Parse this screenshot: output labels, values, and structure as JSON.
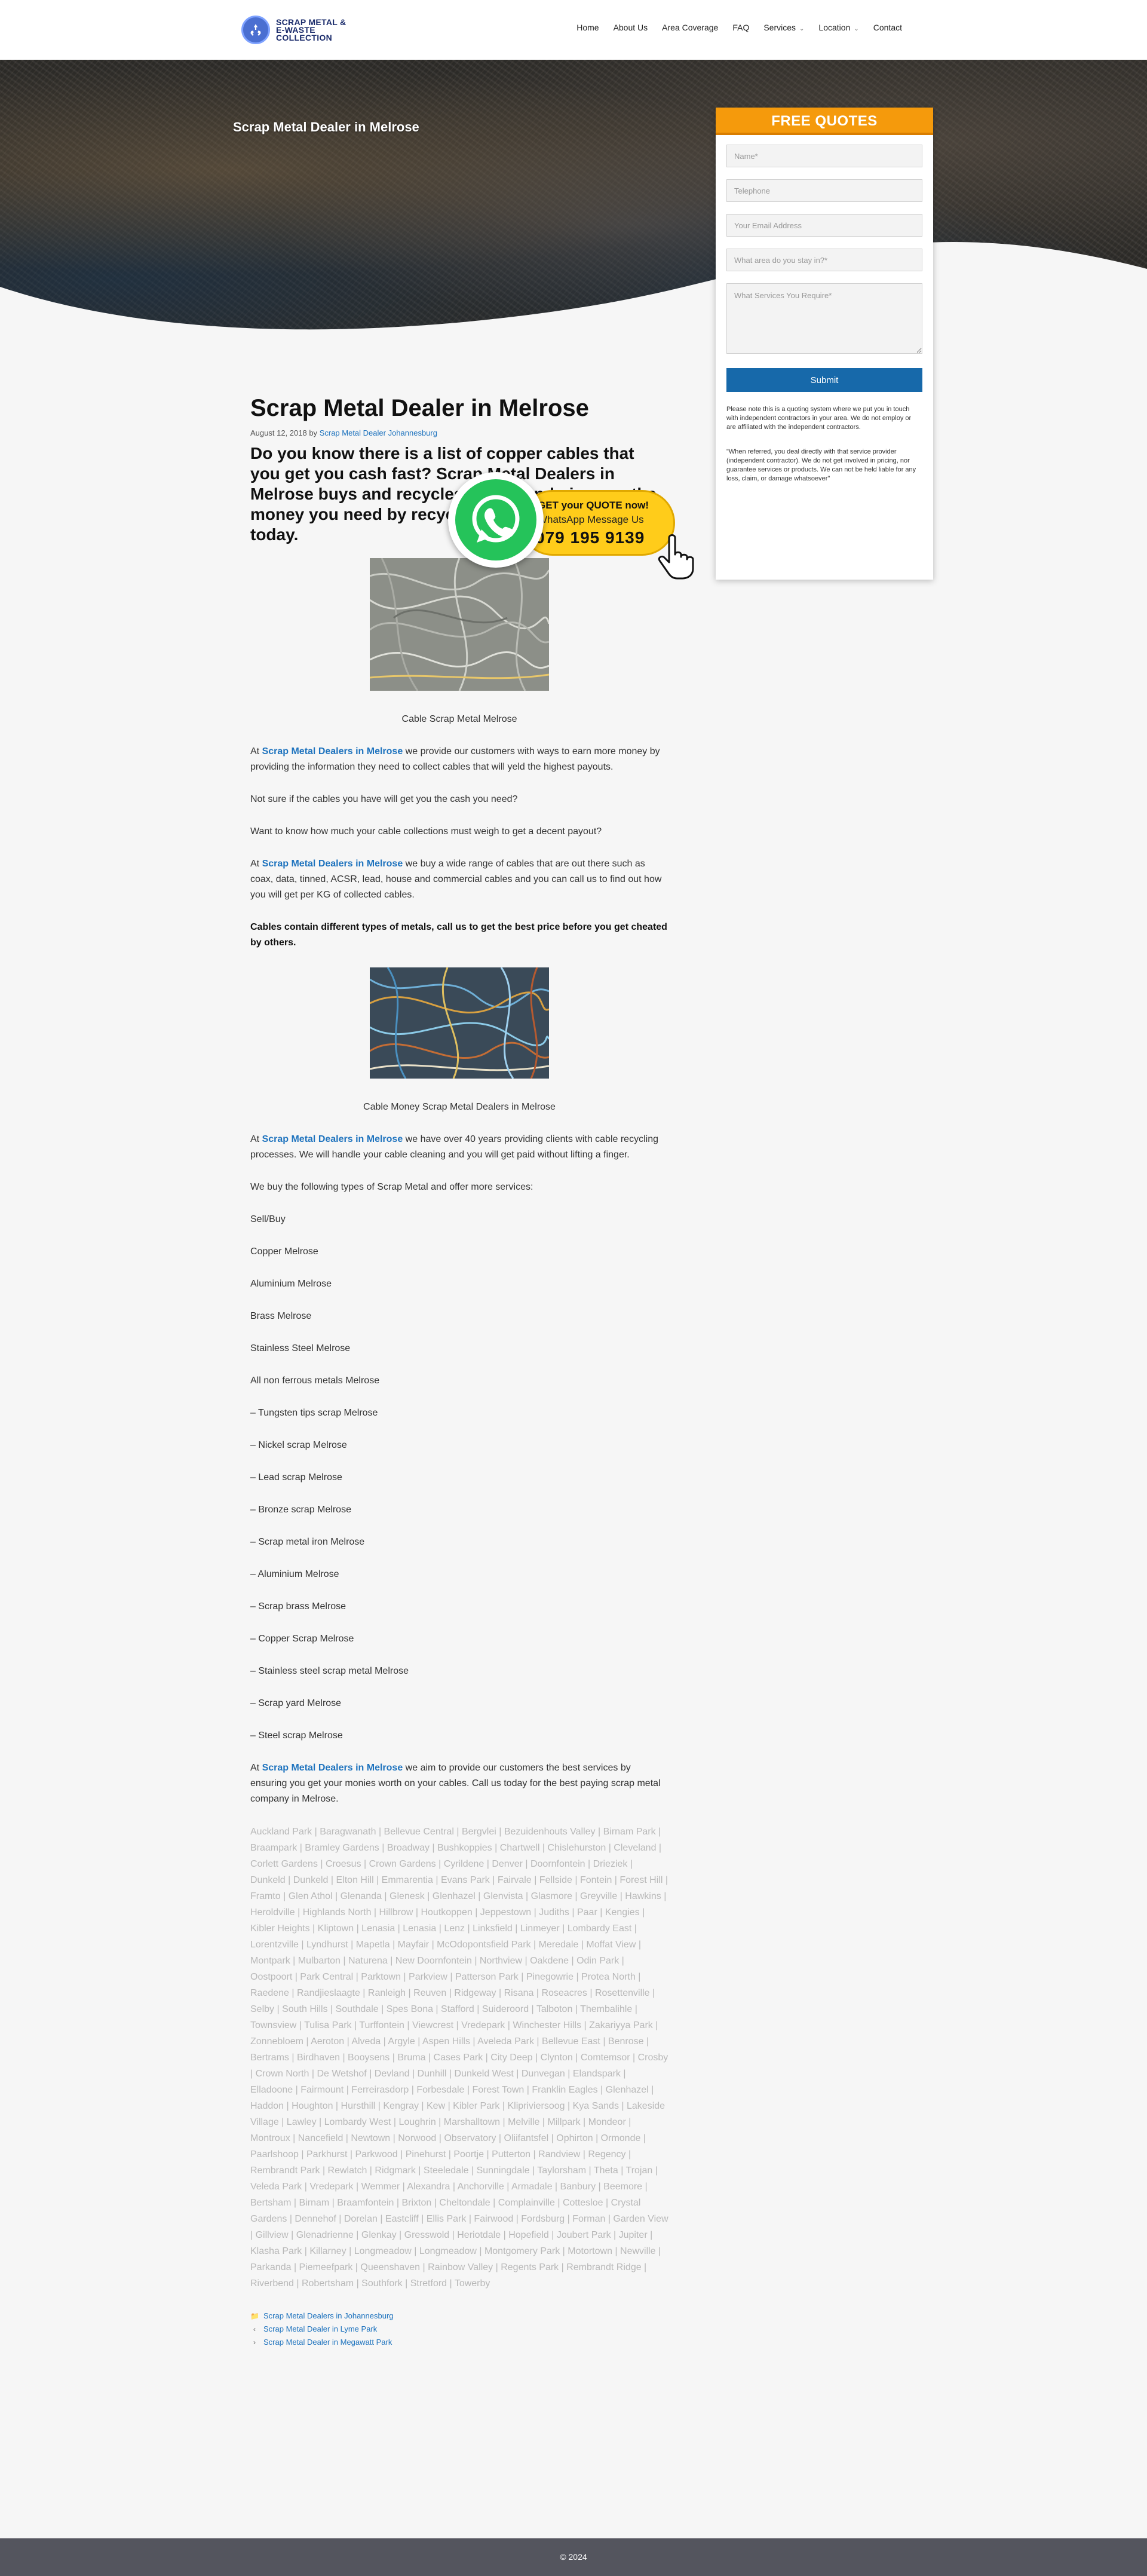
{
  "header": {
    "logo_text": "SCRAP METAL & E-WASTE COLLECTION",
    "nav": [
      {
        "label": "Home"
      },
      {
        "label": "About Us"
      },
      {
        "label": "Area Coverage"
      },
      {
        "label": "FAQ"
      },
      {
        "label": "Services",
        "has_dropdown": true
      },
      {
        "label": "Location",
        "has_dropdown": true
      },
      {
        "label": "Contact"
      }
    ]
  },
  "hero": {
    "title": "Scrap Metal Dealer in Melrose"
  },
  "quote_form": {
    "title": "FREE QUOTES",
    "name_placeholder": "Name*",
    "phone_placeholder": "Telephone",
    "email_placeholder": "Your Email Address",
    "area_placeholder": "What area do you stay in?*",
    "services_placeholder": "What Services You Require*",
    "submit_label": "Submit",
    "note1": "Please note this is a quoting system where we put you in touch with independent contractors in your area. We do not employ or are affiliated with the independent contractors.",
    "note2": "\"When referred, you deal directly with that service provider (independent contractor). We do not get involved in pricing, nor guarantee services or products. We can not be held liable for any loss, claim, or damage whatsoever\""
  },
  "whatsapp": {
    "cta": "GET your QUOTE now!",
    "message": "WhatsApp Message Us",
    "number": "079 195 9139"
  },
  "article": {
    "title": "Scrap Metal Dealer in Melrose",
    "date": "August 12, 2018",
    "by": "by",
    "author": "Scrap Metal Dealer Johannesburg",
    "lead": "Do you know there is a list of copper cables that you get you cash fast? Scrap Metal Dealers in Melrose buys and recycles cables and give you the money you need by recycling your copper cables today.",
    "caption1": "Cable Scrap Metal  Melrose",
    "p1_pre": "At ",
    "p1_link": "Scrap Metal Dealers in Melrose",
    "p1_post": " we provide our customers with ways to earn more money by providing the information they need to collect cables that will yeld the highest payouts.",
    "p2": "Not sure if the cables you have will get you the cash you need?",
    "p3": "Want to know how much your cable collections must weigh to get a decent payout?",
    "p4_pre": "At ",
    "p4_link": "Scrap Metal Dealers in Melrose",
    "p4_post": " we buy a wide range of cables that are out there such as coax, data, tinned, ACSR, lead, house and commercial cables and you can call us to find out how you will get per KG of collected cables.",
    "p5": "Cables contain different types of metals, call us to get the best price before you get cheated by others.",
    "caption2": "Cable Money Scrap Metal Dealers in Melrose",
    "p6_pre": "At ",
    "p6_link": "Scrap Metal Dealers in Melrose",
    "p6_post": " we have over 40 years providing clients with cable recycling processes. We will handle your cable cleaning and you will get paid without lifting a finger.",
    "p7": "We buy the following types of Scrap Metal and offer more services:",
    "list": [
      "Sell/Buy",
      "Copper Melrose",
      "Aluminium Melrose",
      "Brass Melrose",
      "Stainless Steel  Melrose",
      "All non ferrous metals Melrose",
      "– Tungsten tips scrap Melrose",
      "– Nickel scrap Melrose",
      "– Lead scrap Melrose",
      "– Bronze scrap Melrose",
      "– Scrap metal iron Melrose",
      "– Aluminium Melrose",
      "– Scrap brass Melrose",
      "– Copper Scrap Melrose",
      "– Stainless steel scrap metal Melrose",
      "– Scrap yard Melrose",
      "– Steel scrap Melrose"
    ],
    "p8_pre": "At ",
    "p8_link": "Scrap Metal Dealers in Melrose",
    "p8_post": " we aim to provide our customers the best services by ensuring you get your monies worth on your cables. Call us today for the best paying scrap metal company in Melrose.",
    "areas": "Auckland Park | Baragwanath | Bellevue Central | Bergvlei | Bezuidenhouts Valley | Birnam Park | Braampark | Bramley Gardens | Broadway | Bushkoppies | Chartwell | Chislehurston | Cleveland | Corlett Gardens | Croesus | Crown Gardens | Cyrildene | Denver | Doornfontein | Drieziek | Dunkeld | Dunkeld | Elton Hill | Emmarentia | Evans Park | Fairvale | Fellside | Fontein | Forest Hill | Framto | Glen Athol | Glenanda | Glenesk | Glenhazel | Glenvista | Glasmore | Greyville | Hawkins | Heroldville | Highlands North | Hillbrow | Houtkoppen | Jeppestown | Judiths | Paar | Kengies | Kibler Heights | Kliptown | Lenasia | Lenasia | Lenz | Linksfield | Linmeyer | Lombardy East | Lorentzville | Lyndhurst | Mapetla | Mayfair | McOdopontsfield Park | Meredale | Moffat View | Montpark | Mulbarton | Naturena | New Doornfontein | Northview | Oakdene | Odin Park | Oostpoort | Park Central | Parktown | Parkview | Patterson Park | Pinegowrie | Protea North | Raedene | Randjieslaagte | Ranleigh | Reuven | Ridgeway | Risana | Roseacres | Rosettenville | Selby | South Hills | Southdale | Spes Bona | Stafford | Suideroord | Talboton | Thembalihle | Townsview | Tulisa Park | Turffontein | Viewcrest | Vredepark | Winchester Hills | Zakariyya Park | Zonnebloem | Aeroton | Alveda | Argyle | Aspen Hills | Aveleda Park | Bellevue East | Benrose | Bertrams | Birdhaven | Booysens | Bruma | Cases Park | City Deep | Clynton | Comtemsor | Crosby | Crown North | De Wetshof | Devland | Dunhill | Dunkeld West | Dunvegan | Elandspark | Elladoone | Fairmount | Ferreirasdorp | Forbesdale | Forest Town | Franklin Eagles | Glenhazel | Haddon | Houghton | Hursthill | Kengray | Kew | Kibler Park | Klipriviersoog | Kya Sands | Lakeside Village | Lawley | Lombardy West | Loughrin | Marshalltown | Melville | Millpark | Mondeor | Montroux | Nancefield | Newtown | Norwood | Observatory | Oliifantsfel | Ophirton | Ormonde | Paarlshoop | Parkhurst | Parkwood | Pinehurst | Poortje | Putterton | Randview | Regency | Rembrandt Park | Rewlatch | Ridgmark | Steeledale | Sunningdale | Taylorsham | Theta | Trojan | Veleda Park | Vredepark | Wemmer | Alexandra | Anchorville | Armadale | Banbury | Beemore | Bertsham | Birnam | Braamfontein | Brixton | Cheltondale | Complainville | Cottesloe | Crystal Gardens | Dennehof | Dorelan | Eastcliff | Ellis Park | Fairwood | Fordsburg | Forman | Garden View | Gillview | Glenadrienne | Glenkay | Gresswold | Heriotdale | Hopefield | Joubert Park | Jupiter | Klasha Park | Killarney | Longmeadow | Longmeadow | Montgomery Park | Motortown | Newville | Parkanda | Piemeefpark | Queenshaven | Rainbow Valley | Regents Park | Rembrandt Ridge | Riverbend | Robertsham | Southfork | Stretford | Towerby",
    "category_link": "Scrap Metal Dealers in Johannesburg",
    "prev_link": "Scrap Metal Dealer in Lyme Park",
    "next_link": "Scrap Metal Dealer in Megawatt Park"
  },
  "footer": {
    "copyright": "© 2024"
  },
  "colors": {
    "accent": "#f59a0c",
    "link": "#1e73be",
    "button": "#1769aa",
    "footer": "#54555e",
    "whatsapp": "#25c35a",
    "whatsapp_pill": "#ffcc1a"
  }
}
